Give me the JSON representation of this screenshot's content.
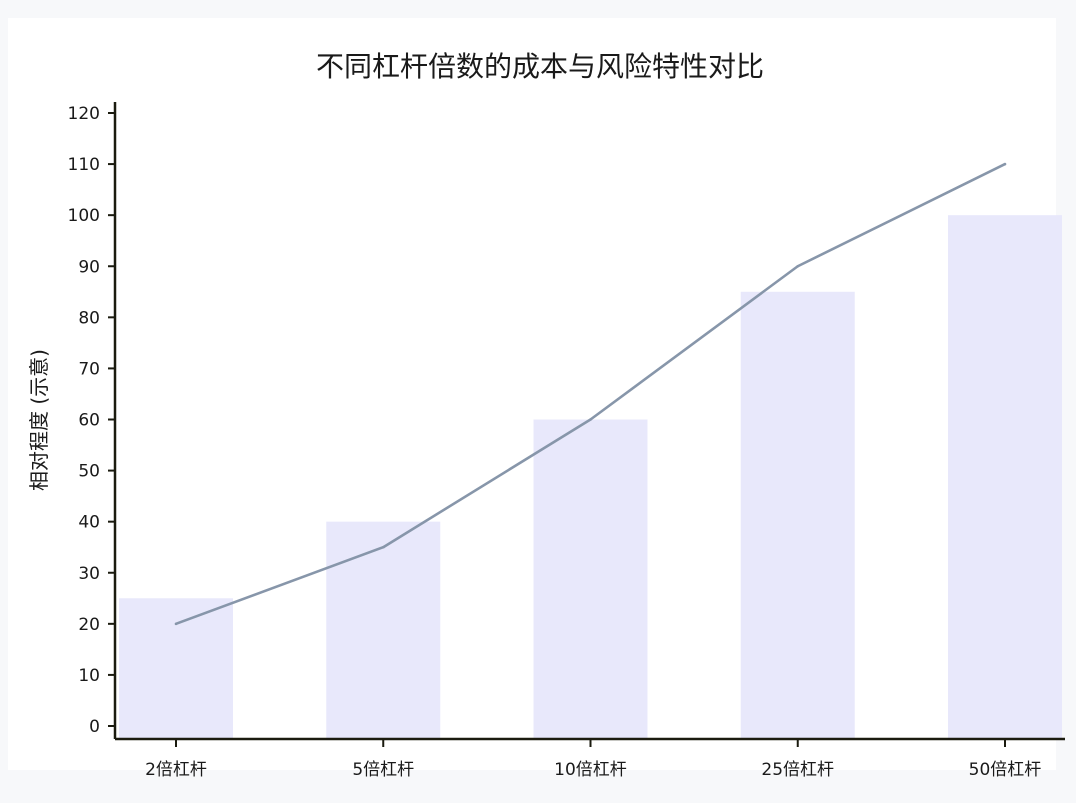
{
  "chart_data": {
    "type": "bar",
    "title": "不同杠杆倍数的成本与风险特性对比",
    "xlabel": "",
    "ylabel": "相对程度 (示意)",
    "categories": [
      "2倍杠杆",
      "5倍杠杆",
      "10倍杠杆",
      "25倍杠杆",
      "50倍杠杆"
    ],
    "bar_values": [
      25,
      40,
      60,
      85,
      100
    ],
    "line_values": [
      20,
      35,
      60,
      90,
      110
    ],
    "ylim": [
      0,
      120
    ],
    "yticks": [
      0,
      10,
      20,
      30,
      40,
      50,
      60,
      70,
      80,
      90,
      100,
      110,
      120
    ],
    "grid": false,
    "colors": {
      "bar": "#e8e8fb",
      "line": "#8796aa"
    }
  }
}
